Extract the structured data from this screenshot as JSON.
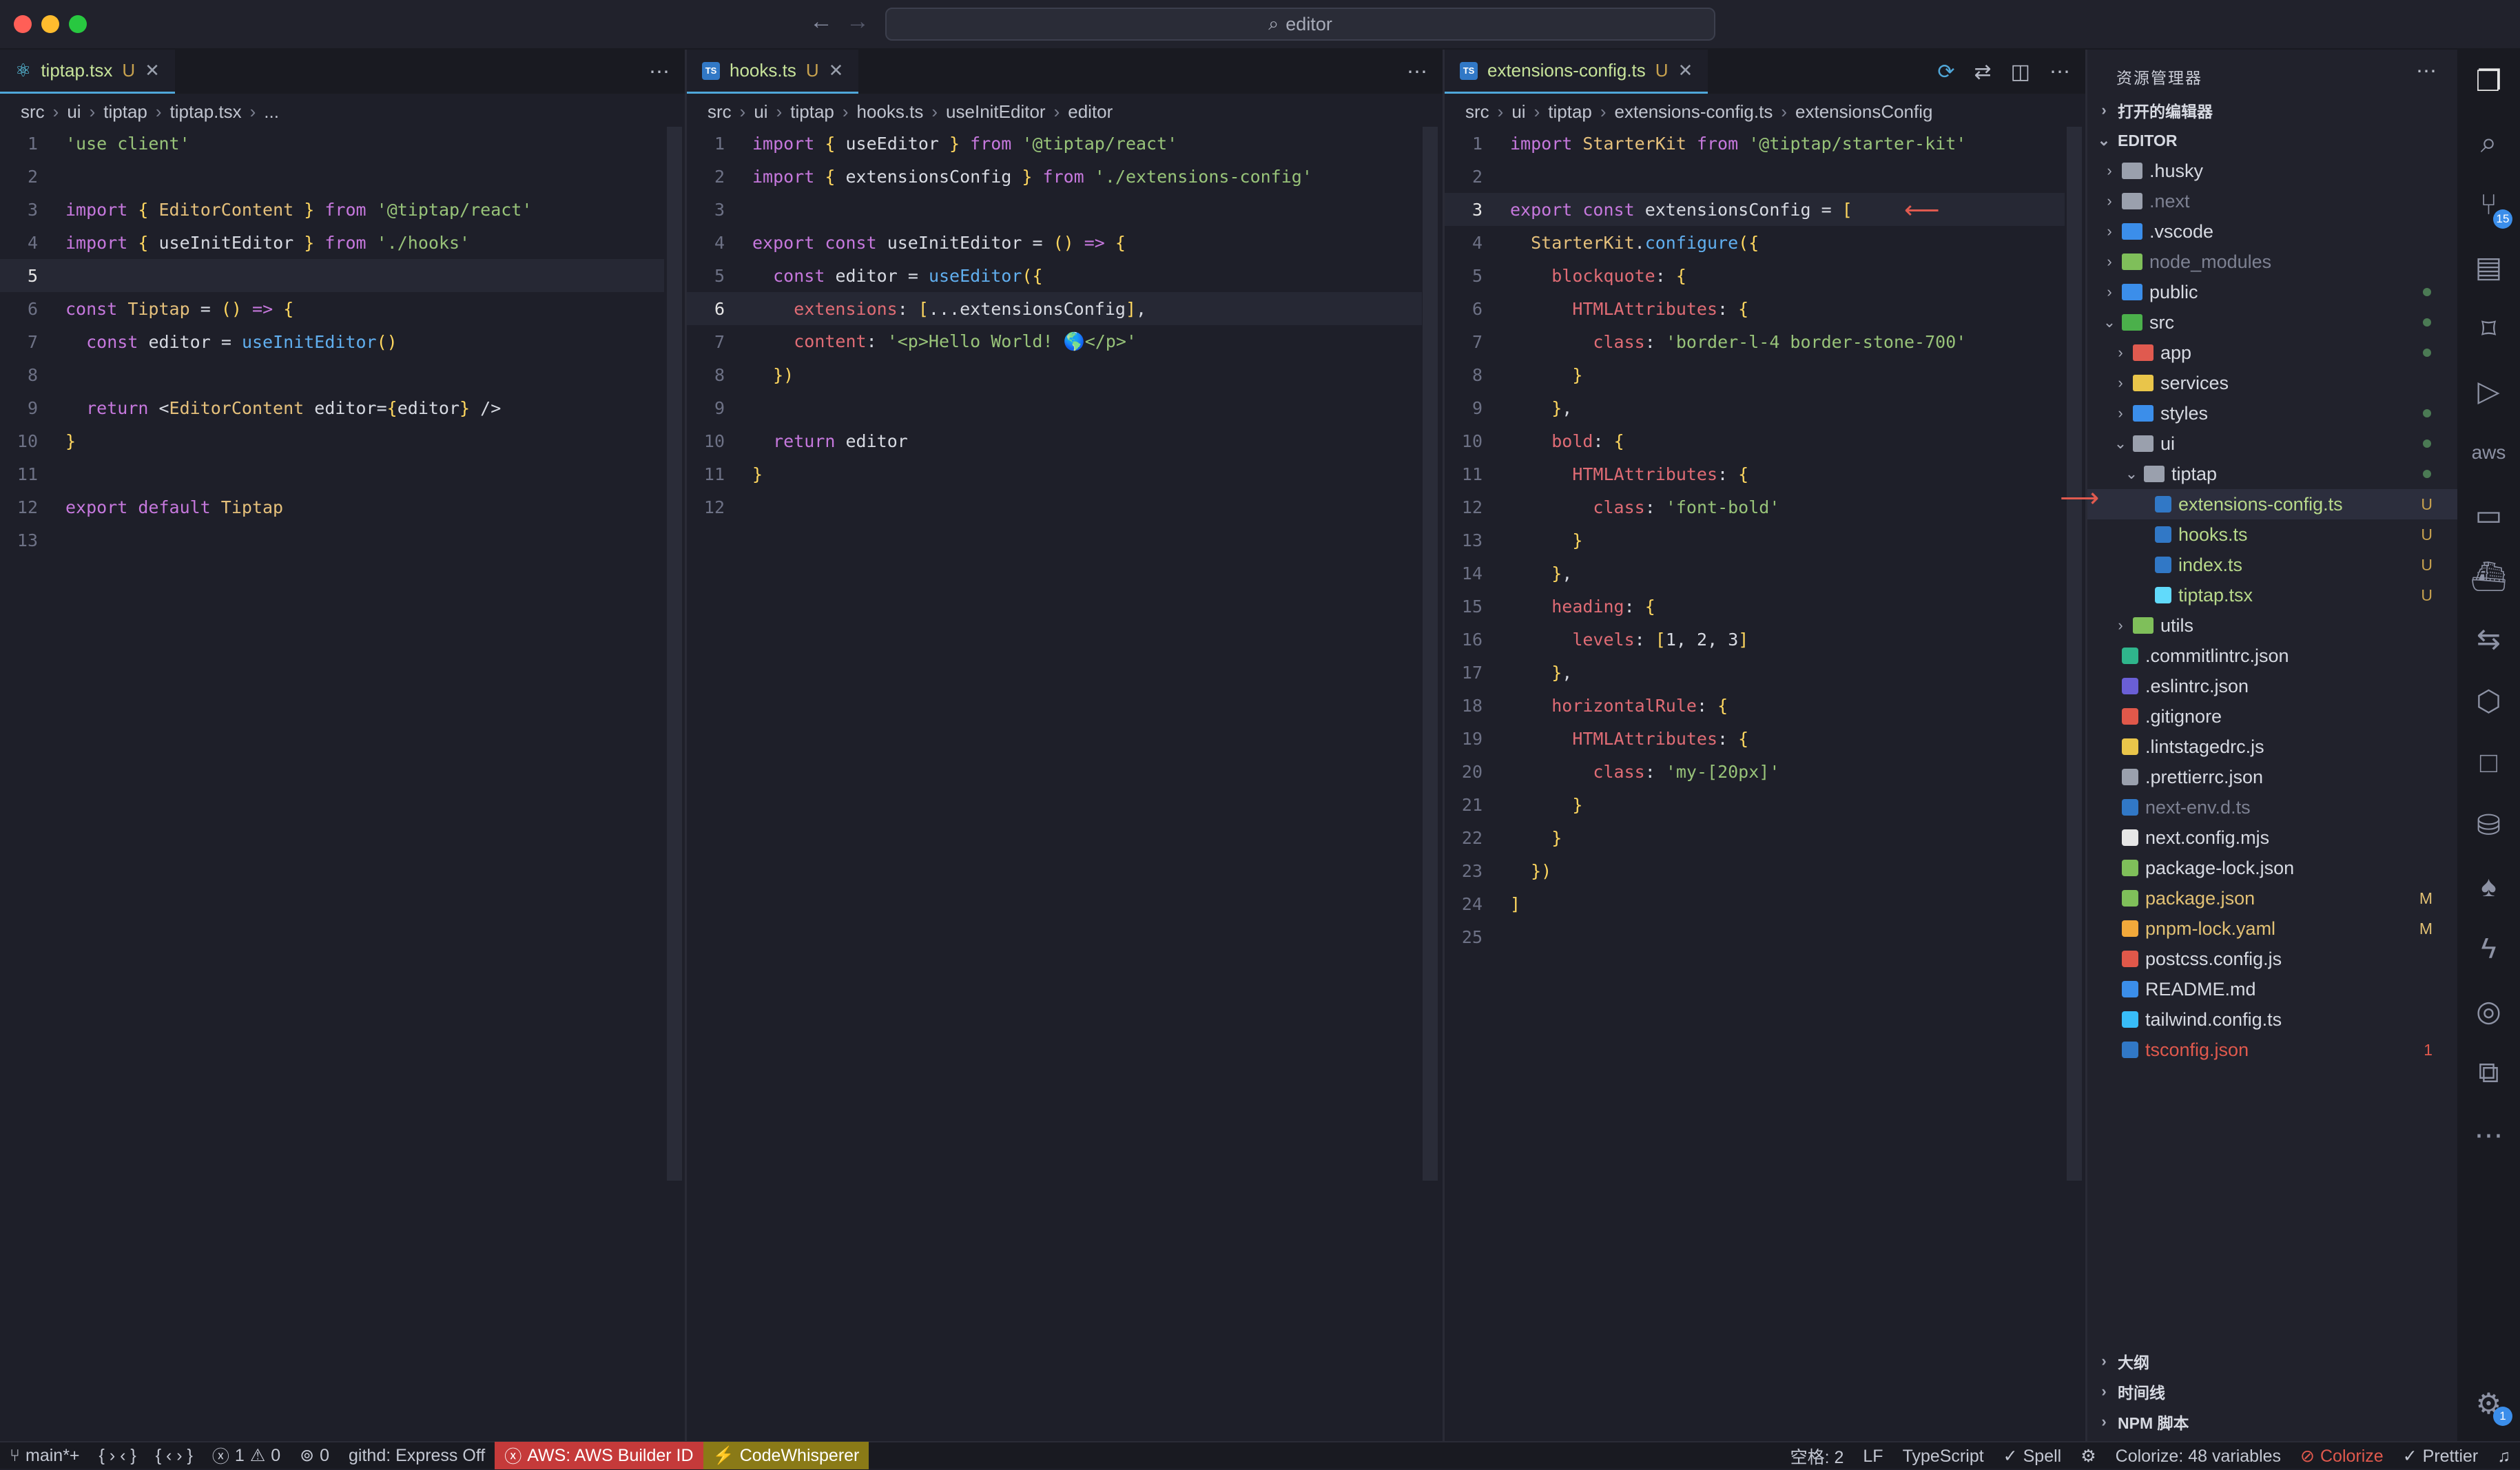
{
  "window": {
    "search_text": "editor"
  },
  "colors": {
    "accent": "#50a7d9",
    "status_aws_bg": "#c53a3a",
    "status_cw_bg": "#8a7a17",
    "untracked": "#c7a14e",
    "error": "#e0594d"
  },
  "editors": [
    {
      "tab": {
        "name": "tiptap.tsx",
        "status": "U"
      },
      "breadcrumb": [
        "src",
        "ui",
        "tiptap",
        "tiptap.tsx",
        "..."
      ],
      "lines": [
        "'use client'",
        "",
        "import { EditorContent } from '@tiptap/react'",
        "import { useInitEditor } from './hooks'",
        "",
        "const Tiptap = () => {",
        "  const editor = useInitEditor()",
        "",
        "  return <EditorContent editor={editor} />",
        "}",
        "",
        "export default Tiptap",
        ""
      ],
      "current_line": 5
    },
    {
      "tab": {
        "name": "hooks.ts",
        "status": "U"
      },
      "breadcrumb": [
        "src",
        "ui",
        "tiptap",
        "hooks.ts",
        "useInitEditor",
        "editor"
      ],
      "lines": [
        "import { useEditor } from '@tiptap/react'",
        "import { extensionsConfig } from './extensions-config'",
        "",
        "export const useInitEditor = () => {",
        "  const editor = useEditor({",
        "    extensions: [...extensionsConfig],",
        "    content: '<p>Hello World! 🌎</p>'",
        "  })",
        "",
        "  return editor",
        "}",
        ""
      ],
      "current_line": 6
    },
    {
      "tab": {
        "name": "extensions-config.ts",
        "status": "U"
      },
      "breadcrumb": [
        "src",
        "ui",
        "tiptap",
        "extensions-config.ts",
        "extensionsConfig"
      ],
      "lines": [
        "import StarterKit from '@tiptap/starter-kit'",
        "",
        "export const extensionsConfig = [",
        "  StarterKit.configure({",
        "    blockquote: {",
        "      HTMLAttributes: {",
        "        class: 'border-l-4 border-stone-700'",
        "      }",
        "    },",
        "    bold: {",
        "      HTMLAttributes: {",
        "        class: 'font-bold'",
        "      }",
        "    },",
        "    heading: {",
        "      levels: [1, 2, 3]",
        "    },",
        "    horizontalRule: {",
        "      HTMLAttributes: {",
        "        class: 'my-[20px]'",
        "      }",
        "    }",
        "  })",
        "]",
        ""
      ],
      "current_line": 3
    }
  ],
  "explorer": {
    "title": "资源管理器",
    "open_editors": "打开的编辑器",
    "root": "EDITOR",
    "items": [
      {
        "name": ".husky",
        "depth": 1,
        "kind": "folder",
        "open": false,
        "icon": "folder-icon",
        "color": "#9aa0ad"
      },
      {
        "name": ".next",
        "depth": 1,
        "kind": "folder",
        "open": false,
        "icon": "folder-icon",
        "color": "#9aa0ad",
        "dim": true
      },
      {
        "name": ".vscode",
        "depth": 1,
        "kind": "folder",
        "open": false,
        "icon": "folder-icon",
        "color": "#3b8eea"
      },
      {
        "name": "node_modules",
        "depth": 1,
        "kind": "folder",
        "open": false,
        "icon": "folder-icon",
        "color": "#7fbf5a",
        "dim": true
      },
      {
        "name": "public",
        "depth": 1,
        "kind": "folder",
        "open": false,
        "icon": "folder-icon",
        "color": "#3b8eea",
        "dot": true
      },
      {
        "name": "src",
        "depth": 1,
        "kind": "folder",
        "open": true,
        "icon": "folder-icon",
        "color": "#4bb04b",
        "dot": true
      },
      {
        "name": "app",
        "depth": 2,
        "kind": "folder",
        "open": false,
        "icon": "folder-icon",
        "color": "#e05a4f",
        "dot": true
      },
      {
        "name": "services",
        "depth": 2,
        "kind": "folder",
        "open": false,
        "icon": "folder-icon",
        "color": "#e9c54a"
      },
      {
        "name": "styles",
        "depth": 2,
        "kind": "folder",
        "open": false,
        "icon": "folder-icon",
        "color": "#3b8eea",
        "dot": true
      },
      {
        "name": "ui",
        "depth": 2,
        "kind": "folder",
        "open": true,
        "icon": "folder-icon",
        "color": "#9aa0ad",
        "dot": true
      },
      {
        "name": "tiptap",
        "depth": 3,
        "kind": "folder",
        "open": true,
        "icon": "folder-icon",
        "color": "#9aa0ad",
        "dot": true
      },
      {
        "name": "extensions-config.ts",
        "depth": 4,
        "kind": "file",
        "icon": "typescript-icon",
        "color": "#3178c6",
        "badge": "U",
        "selected": true
      },
      {
        "name": "hooks.ts",
        "depth": 4,
        "kind": "file",
        "icon": "typescript-icon",
        "color": "#3178c6",
        "badge": "U"
      },
      {
        "name": "index.ts",
        "depth": 4,
        "kind": "file",
        "icon": "typescript-icon",
        "color": "#3178c6",
        "badge": "U"
      },
      {
        "name": "tiptap.tsx",
        "depth": 4,
        "kind": "file",
        "icon": "react-icon",
        "color": "#61dafb",
        "badge": "U"
      },
      {
        "name": "utils",
        "depth": 2,
        "kind": "folder",
        "open": false,
        "icon": "folder-icon",
        "color": "#7fbf5a"
      },
      {
        "name": ".commitlintrc.json",
        "depth": 1,
        "kind": "file",
        "icon": "commitlint-icon",
        "color": "#2fb58c"
      },
      {
        "name": ".eslintrc.json",
        "depth": 1,
        "kind": "file",
        "icon": "eslint-icon",
        "color": "#6a5fd6"
      },
      {
        "name": ".gitignore",
        "depth": 1,
        "kind": "file",
        "icon": "git-icon",
        "color": "#e0584a"
      },
      {
        "name": ".lintstagedrc.js",
        "depth": 1,
        "kind": "file",
        "icon": "javascript-icon",
        "color": "#e9c54a"
      },
      {
        "name": ".prettierrc.json",
        "depth": 1,
        "kind": "file",
        "icon": "prettier-icon",
        "color": "#9aa0ad"
      },
      {
        "name": "next-env.d.ts",
        "depth": 1,
        "kind": "file",
        "icon": "typescript-def-icon",
        "color": "#3178c6",
        "dim": true
      },
      {
        "name": "next.config.mjs",
        "depth": 1,
        "kind": "file",
        "icon": "nextjs-icon",
        "color": "#e6e6e6"
      },
      {
        "name": "package-lock.json",
        "depth": 1,
        "kind": "file",
        "icon": "npm-icon",
        "color": "#7fbf5a"
      },
      {
        "name": "package.json",
        "depth": 1,
        "kind": "file",
        "icon": "npm-icon",
        "color": "#7fbf5a",
        "badge": "M",
        "modified": true
      },
      {
        "name": "pnpm-lock.yaml",
        "depth": 1,
        "kind": "file",
        "icon": "pnpm-icon",
        "color": "#f2a93b",
        "badge": "M",
        "modified": true
      },
      {
        "name": "postcss.config.js",
        "depth": 1,
        "kind": "file",
        "icon": "postcss-icon",
        "color": "#e0584a"
      },
      {
        "name": "README.md",
        "depth": 1,
        "kind": "file",
        "icon": "info-icon",
        "color": "#3b8eea"
      },
      {
        "name": "tailwind.config.ts",
        "depth": 1,
        "kind": "file",
        "icon": "tailwind-icon",
        "color": "#38bdf8"
      },
      {
        "name": "tsconfig.json",
        "depth": 1,
        "kind": "file",
        "icon": "tsconfig-icon",
        "color": "#3178c6",
        "badge": "1",
        "error": true
      }
    ],
    "sections": [
      "大纲",
      "时间线",
      "NPM 脚本"
    ]
  },
  "activity_badges": {
    "source_control": "15",
    "settings": "1"
  },
  "statusbar": {
    "branch": "main*+",
    "nav1": "{ › ‹ }",
    "nav2": "{ ‹ › }",
    "problems_errors": "1",
    "problems_warnings": "0",
    "ports": "0",
    "githd": "githd: Express Off",
    "aws": "AWS: AWS Builder ID",
    "codewhisperer": "CodeWhisperer",
    "spaces": "空格: 2",
    "eol": "LF",
    "language": "TypeScript",
    "spell": "Spell",
    "colorize_vars": "Colorize: 48 variables",
    "colorize": "Colorize",
    "prettier": "Prettier"
  }
}
